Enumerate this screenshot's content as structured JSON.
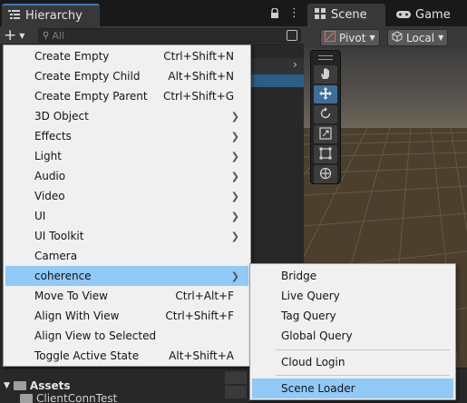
{
  "hierarchy": {
    "tab_title": "Hierarchy",
    "search_placeholder": "All"
  },
  "scene": {
    "scene_tab": "Scene",
    "game_tab": "Game",
    "pivot_label": "Pivot",
    "local_label": "Local"
  },
  "project": {
    "assets_label": "Assets",
    "subfolder_label": "ClientConnTest"
  },
  "menu": {
    "items": [
      {
        "label": "Create Empty",
        "shortcut": "Ctrl+Shift+N",
        "submenu": false
      },
      {
        "label": "Create Empty Child",
        "shortcut": "Alt+Shift+N",
        "submenu": false
      },
      {
        "label": "Create Empty Parent",
        "shortcut": "Ctrl+Shift+G",
        "submenu": false
      },
      {
        "label": "3D Object",
        "shortcut": "",
        "submenu": true
      },
      {
        "label": "Effects",
        "shortcut": "",
        "submenu": true
      },
      {
        "label": "Light",
        "shortcut": "",
        "submenu": true
      },
      {
        "label": "Audio",
        "shortcut": "",
        "submenu": true
      },
      {
        "label": "Video",
        "shortcut": "",
        "submenu": true
      },
      {
        "label": "UI",
        "shortcut": "",
        "submenu": true
      },
      {
        "label": "UI Toolkit",
        "shortcut": "",
        "submenu": true
      },
      {
        "label": "Camera",
        "shortcut": "",
        "submenu": false
      },
      {
        "label": "coherence",
        "shortcut": "",
        "submenu": true,
        "highlighted": true
      },
      {
        "label": "Move To View",
        "shortcut": "Ctrl+Alt+F",
        "submenu": false
      },
      {
        "label": "Align With View",
        "shortcut": "Ctrl+Shift+F",
        "submenu": false
      },
      {
        "label": "Align View to Selected",
        "shortcut": "",
        "submenu": false
      },
      {
        "label": "Toggle Active State",
        "shortcut": "Alt+Shift+A",
        "submenu": false
      }
    ]
  },
  "submenu": {
    "items": [
      {
        "label": "Bridge"
      },
      {
        "label": "Live Query"
      },
      {
        "label": "Tag Query"
      },
      {
        "label": "Global Query"
      },
      {
        "label": "Cloud Login"
      },
      {
        "label": "Scene Loader",
        "highlighted": true
      }
    ]
  },
  "colors": {
    "menu_background": "#f0f0f0",
    "menu_highlight": "#91c9f7",
    "active_tool": "#3f6d99",
    "tab_accent": "#3a79bb"
  },
  "icons": {
    "hierarchy_tab": "hierarchy-list-icon",
    "lock": "lock-icon",
    "search": "search-icon",
    "scene_tab": "scene-grid-icon",
    "game_tab": "gamepad-icon",
    "tools": [
      "hand-tool-icon",
      "move-tool-icon",
      "rotate-tool-icon",
      "scale-tool-icon",
      "rect-tool-icon",
      "transform-tool-icon"
    ]
  }
}
